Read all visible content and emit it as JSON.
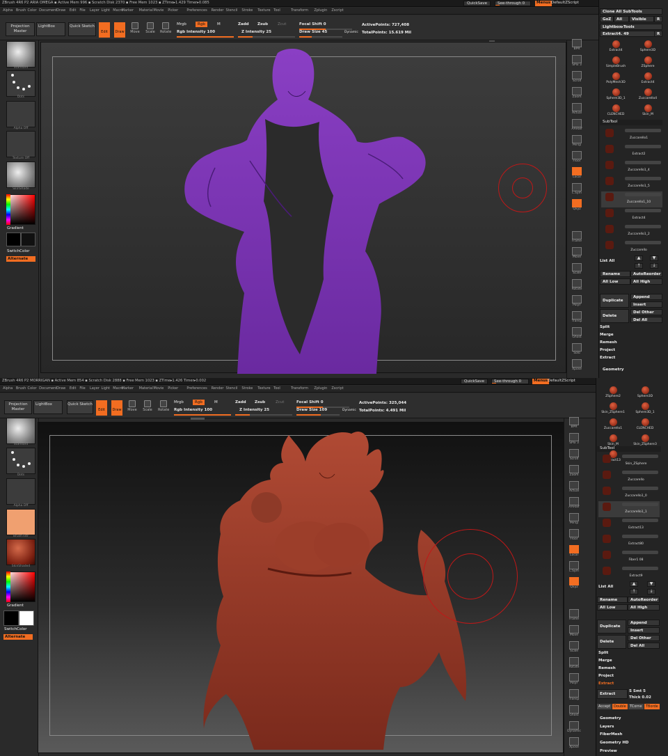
{
  "colors": {
    "accent": "#f26d21",
    "model_top": "#7a2fb0",
    "model_bottom": "#a0402c",
    "brush_ring": "#c01818"
  },
  "panes": [
    {
      "title": "ZBrush 4R6 P2     ARIA OMEGA     ▪ Active Mem 996 ▪ Scratch Disk 2370 ▪ Free Mem 1023 ▪ ZTime▸1.429  Timer▸0.085",
      "quicksave": "QuickSave",
      "see_through": "See-through  0",
      "menus": "Menus",
      "default_script": "DefaultZScript",
      "menu_items": [
        "Alpha",
        "Brush",
        "Color",
        "Document",
        "Draw",
        "Edit",
        "File",
        "Layer",
        "Light",
        "Macro",
        "Marker",
        "Material",
        "Movie",
        "Picker",
        "Preferences",
        "Render",
        "Stencil",
        "Stroke",
        "Texture",
        "Tool",
        "Transform",
        "Zplugin",
        "Zscript"
      ],
      "toolbar": {
        "projection_master": "Projection Master",
        "lightbox": "LightBox",
        "quick_sketch": "Quick Sketch",
        "edit": "Edit",
        "draw": "Draw",
        "move": "Move",
        "scale": "Scale",
        "rotate": "Rotate",
        "mrgb": "Mrgb",
        "rgb": "Rgb",
        "m": "M",
        "zadd": "Zadd",
        "zsub": "Zsub",
        "zcut": "Zcut",
        "rgb_intensity": "Rgb Intensity 100",
        "z_intensity": "Z Intensity 25",
        "focal_shift": "Focal Shift 0",
        "draw_size": "Draw Size 45",
        "dynamic": "Dynamic",
        "active_points": "ActivePoints: 727,408",
        "total_points": "TotalPoints: 15.619 Mil"
      },
      "left_shelf": [
        {
          "label": "Standard",
          "kind": "light"
        },
        {
          "label": "Dots",
          "kind": "dots"
        },
        {
          "label": "Alpha Off",
          "kind": "dark"
        },
        {
          "label": "Texture Off",
          "kind": "dark"
        },
        {
          "label": "SkinShade",
          "kind": "light"
        }
      ],
      "gradient": "Gradient",
      "switch_color": "SwitchColor",
      "alternate": "Alternate",
      "right_shelf": [
        "BPR",
        "SPix 3",
        "Scroll",
        "Zoom",
        "Actual",
        "AAHalf",
        "Persp",
        "Floor",
        "Local",
        "L.Sym",
        "Qxyz",
        "",
        "Frame",
        "Move",
        "Scale",
        "Rotate",
        "PolyF",
        "Transp",
        "Ghost",
        "Solo",
        "Xpose"
      ],
      "tool_panel": {
        "clone_all": "Clone All SubTools",
        "goz": "GoZ",
        "all": "All",
        "visible": "Visible",
        "r": "R",
        "lightbox_tools": "Lightbox▸Tools",
        "current": "Extract4. 49",
        "tiles": [
          "Extract4",
          "Sphere3D",
          "SimpleBrush",
          "ZSphere",
          "PolyMesh3D",
          "Extract4",
          "Sphere3D_1",
          "Zuccarello4",
          "CLENCHED",
          "Skin_M"
        ]
      },
      "subtool": {
        "header": "SubTool",
        "items": [
          "Zuccarello1",
          "Extract2",
          "Zuccarello1_4",
          "Zuccarello1_5",
          "Zuccarello1_10",
          "Extract4",
          "Zuccarello1_2",
          "Zuccarello"
        ],
        "list_all": "List All",
        "rename": "Rename",
        "auto_reorder": "AutoReorder",
        "all_low": "All Low",
        "all_high": "All High",
        "duplicate": "Duplicate",
        "append": "Append",
        "insert": "Insert",
        "delete": "Delete",
        "del_other": "Del Other",
        "del_all": "Del All",
        "split": "Split",
        "merge": "Merge",
        "remesh": "Remesh",
        "project": "Project",
        "extract": "Extract",
        "geometry": "Geometry"
      }
    },
    {
      "title": "ZBrush 4R6 P2     MORRIGAN     ▪ Active Mem 854 ▪ Scratch Disk 2888 ▪ Free Mem 1023 ▪ ZTime▸1.426  Timer▸0.002",
      "quicksave": "QuickSave",
      "see_through": "See-through  0",
      "menus": "Menus",
      "default_script": "DefaultZScript",
      "menu_items": [
        "Alpha",
        "Brush",
        "Color",
        "Document",
        "Draw",
        "Edit",
        "File",
        "Layer",
        "Light",
        "Macro",
        "Marker",
        "Material",
        "Movie",
        "Picker",
        "Preferences",
        "Render",
        "Stencil",
        "Stroke",
        "Texture",
        "Tool",
        "Transform",
        "Zplugin",
        "Zscript"
      ],
      "toolbar": {
        "projection_master": "Projection Master",
        "lightbox": "LightBox",
        "quick_sketch": "Quick Sketch",
        "edit": "Edit",
        "draw": "Draw",
        "move": "Move",
        "scale": "Scale",
        "rotate": "Rotate",
        "mrgb": "Mrgb",
        "rgb": "Rgb",
        "m": "M",
        "zadd": "Zadd",
        "zsub": "Zsub",
        "zcut": "Zcut",
        "rgb_intensity": "Rgb Intensity 100",
        "z_intensity": "Z Intensity 25",
        "focal_shift": "Focal Shift 0",
        "draw_size": "Draw Size 109",
        "dynamic": "Dynamic",
        "active_points": "ActivePoints: 325,044",
        "total_points": "TotalPoints: 4.491 Mil"
      },
      "left_shelf": [
        {
          "label": "Standard",
          "kind": "light"
        },
        {
          "label": "Dots",
          "kind": "dots"
        },
        {
          "label": "Alpha Off",
          "kind": "dark"
        },
        {
          "label": "BrushTxtr",
          "kind": "peach"
        },
        {
          "label": "SkinShade4",
          "kind": "redsphere"
        }
      ],
      "gradient": "Gradient",
      "switch_color": "SwitchColor",
      "alternate": "Alternate",
      "right_shelf": [
        "BPR",
        "SPix 3",
        "Scroll",
        "Zoom",
        "Actual",
        "AAHalf",
        "Persp",
        "Floor",
        "Local",
        "L.Sym",
        "Qxyz",
        "",
        "Frame",
        "Move",
        "Scale",
        "Rotate",
        "PolyF",
        "Transp",
        "Ghost",
        "Dynamic",
        "Xpose"
      ],
      "tool_panel": {
        "tiles": [
          "ZSphere2",
          "Sphere3D",
          "Skin_ZSphere1",
          "Sphere3D_1",
          "Zuccarello1",
          "CLENCHED",
          "Skin_M",
          "Skin_ZSphere3",
          "Extract13"
        ]
      },
      "subtool": {
        "header": "SubTool",
        "items": [
          "Skin_ZSphere",
          "Zuccarello",
          "Zuccarello1_0",
          "Zuccarello1_1",
          "Extract13",
          "Extract80",
          "Fiber1 08",
          "Extract9"
        ],
        "list_all": "List All",
        "rename": "Rename",
        "auto_reorder": "AutoReorder",
        "all_low": "All Low",
        "all_high": "All High",
        "duplicate": "Duplicate",
        "append": "Append",
        "insert": "Insert",
        "delete": "Delete",
        "del_other": "Del Other",
        "del_all": "Del All",
        "split": "Split",
        "merge": "Merge",
        "remesh": "Remesh",
        "project": "Project",
        "extract": "Extract",
        "extract2": "Extract",
        "s_smt": "S Smt 5",
        "thick": "Thick 0.02",
        "accept": "Accept",
        "double": "Double",
        "tcorne": "TCorne",
        "tborder": "TBorde",
        "geometry": "Geometry",
        "layers": "Layers",
        "fibermesh": "FiberMesh",
        "geometry_hd": "Geometry HD",
        "preview": "Preview"
      }
    }
  ]
}
